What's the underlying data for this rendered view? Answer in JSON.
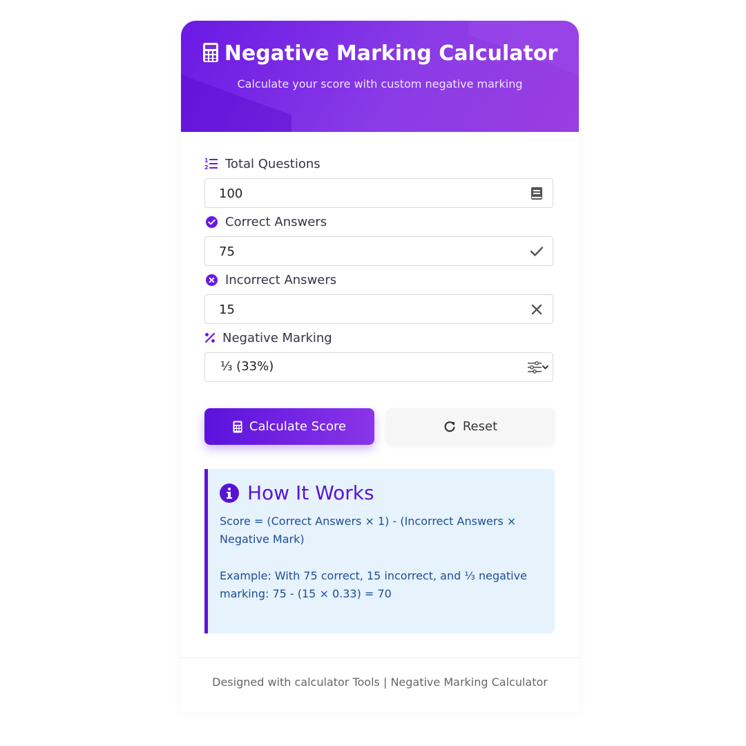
{
  "header": {
    "title": "Negative Marking Calculator",
    "subtitle": "Calculate your score with custom negative marking"
  },
  "fields": {
    "total_questions": {
      "label": "Total Questions",
      "value": "100",
      "icon": "book-icon",
      "label_icon": "ordered-list-icon"
    },
    "correct_answers": {
      "label": "Correct Answers",
      "value": "75",
      "icon": "check-icon",
      "label_icon": "check-circle-icon"
    },
    "incorrect_answers": {
      "label": "Incorrect Answers",
      "value": "15",
      "icon": "x-icon",
      "label_icon": "x-circle-icon"
    },
    "negative_marking": {
      "label": "Negative Marking",
      "value": "⅓ (33%)",
      "icon": "sliders-chevron-icon",
      "label_icon": "percent-icon"
    }
  },
  "buttons": {
    "calculate_label": "Calculate Score",
    "reset_label": "Reset"
  },
  "info": {
    "title": "How It Works",
    "formula": "Score = (Correct Answers × 1) - (Incorrect Answers × Negative Mark)",
    "example": "Example: With 75 correct, 15 incorrect, and ⅓ negative marking: 75 - (15 × 0.33) = 70"
  },
  "footer": {
    "text": "Designed with calculator Tools | Negative Marking Calculator"
  },
  "colors": {
    "accent": "#5c14d8",
    "header_gradient_start": "#6a19e4",
    "header_gradient_end": "#9a3ee0",
    "info_bg": "#e6f2fc",
    "info_text": "#1c4e94"
  }
}
